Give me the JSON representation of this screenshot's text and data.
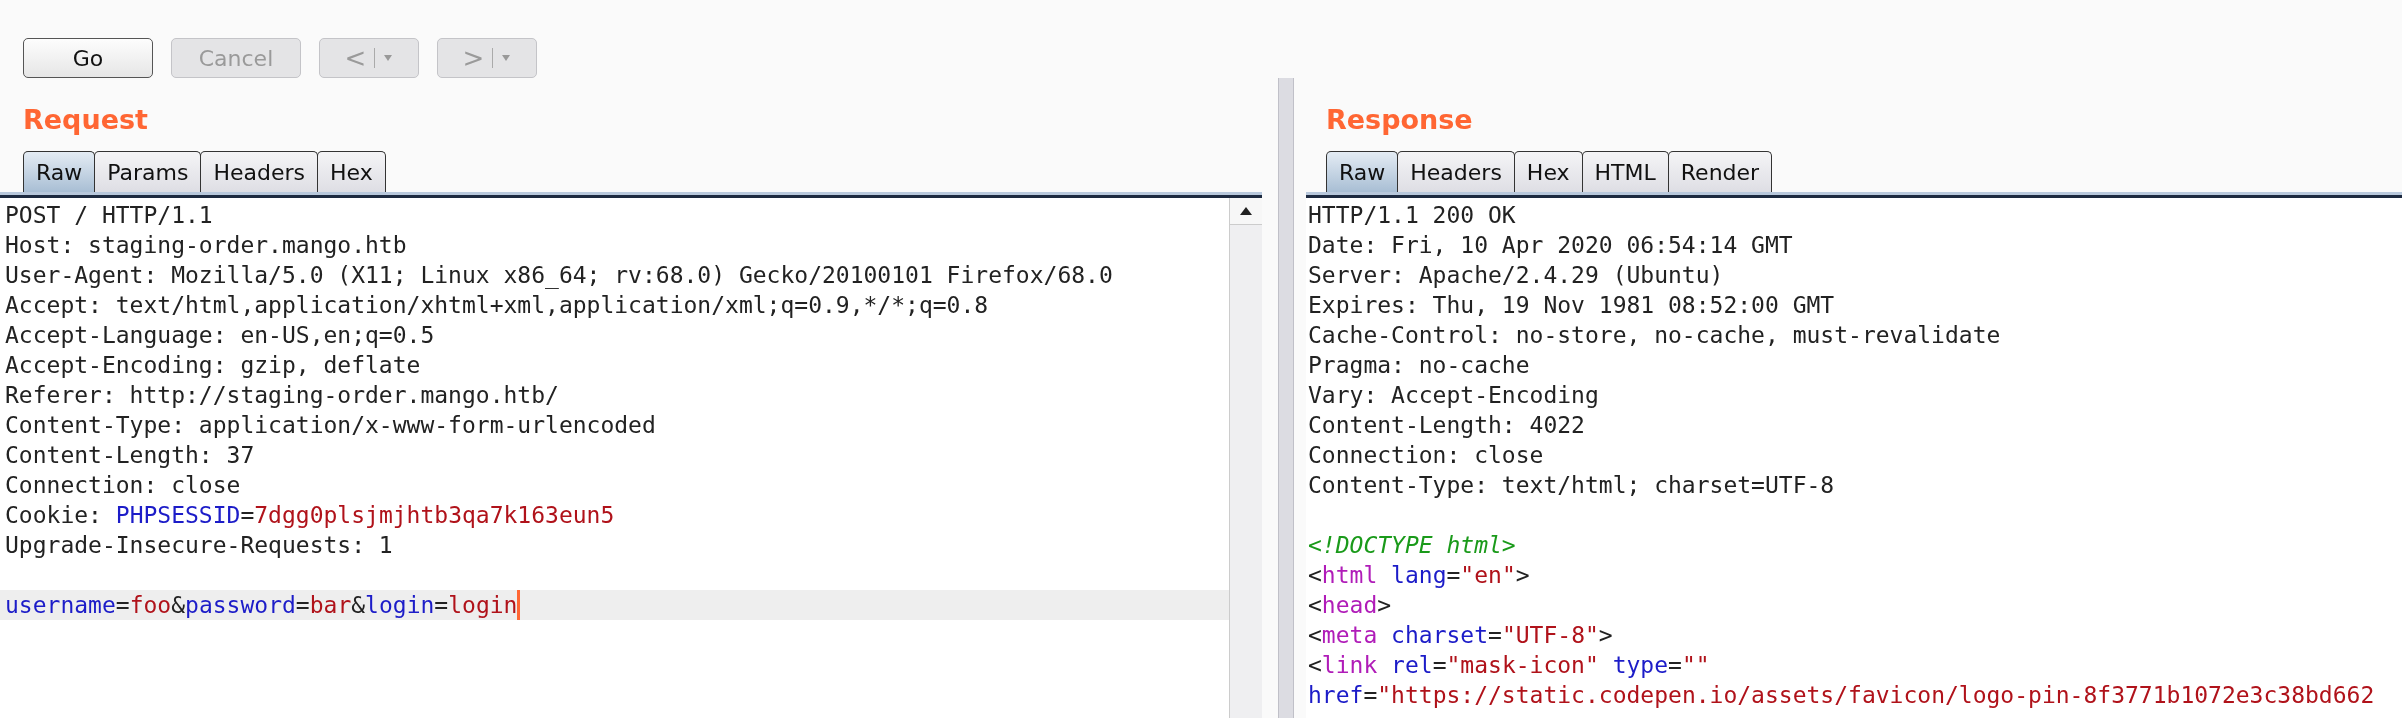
{
  "toolbar": {
    "buttons": [
      {
        "label": "Go",
        "kind": "text",
        "disabled": false
      },
      {
        "label": "Cancel",
        "kind": "text",
        "disabled": true
      },
      {
        "label": "<",
        "kind": "nav",
        "disabled": true
      },
      {
        "label": ">",
        "kind": "nav",
        "disabled": true
      }
    ]
  },
  "request": {
    "title": "Request",
    "tabs": [
      {
        "label": "Raw",
        "selected": true
      },
      {
        "label": "Params",
        "selected": false
      },
      {
        "label": "Headers",
        "selected": false
      },
      {
        "label": "Hex",
        "selected": false
      }
    ],
    "lines": [
      {
        "kind": "text",
        "current": false,
        "segments": [
          {
            "kind": "plain",
            "text": "POST / HTTP/1.1"
          }
        ]
      },
      {
        "kind": "text",
        "current": false,
        "segments": [
          {
            "kind": "plain",
            "text": "Host: staging-order.mango.htb"
          }
        ]
      },
      {
        "kind": "text",
        "current": false,
        "segments": [
          {
            "kind": "plain",
            "text": "User-Agent: Mozilla/5.0 (X11; Linux x86_64; rv:68.0) Gecko/20100101 Firefox/68.0"
          }
        ]
      },
      {
        "kind": "text",
        "current": false,
        "segments": [
          {
            "kind": "plain",
            "text": "Accept: text/html,application/xhtml+xml,application/xml;q=0.9,*/*;q=0.8"
          }
        ]
      },
      {
        "kind": "text",
        "current": false,
        "segments": [
          {
            "kind": "plain",
            "text": "Accept-Language: en-US,en;q=0.5"
          }
        ]
      },
      {
        "kind": "text",
        "current": false,
        "segments": [
          {
            "kind": "plain",
            "text": "Accept-Encoding: gzip, deflate"
          }
        ]
      },
      {
        "kind": "text",
        "current": false,
        "segments": [
          {
            "kind": "plain",
            "text": "Referer: http://staging-order.mango.htb/"
          }
        ]
      },
      {
        "kind": "text",
        "current": false,
        "segments": [
          {
            "kind": "plain",
            "text": "Content-Type: application/x-www-form-urlencoded"
          }
        ]
      },
      {
        "kind": "text",
        "current": false,
        "segments": [
          {
            "kind": "plain",
            "text": "Content-Length: 37"
          }
        ]
      },
      {
        "kind": "text",
        "current": false,
        "segments": [
          {
            "kind": "plain",
            "text": "Connection: close"
          }
        ]
      },
      {
        "kind": "text",
        "current": false,
        "segments": [
          {
            "kind": "plain",
            "text": "Cookie: "
          },
          {
            "kind": "name",
            "text": "PHPSESSID"
          },
          {
            "kind": "plain",
            "text": "="
          },
          {
            "kind": "value",
            "text": "7dgg0plsjmjhtb3qa7k163eun5"
          }
        ]
      },
      {
        "kind": "text",
        "current": false,
        "segments": [
          {
            "kind": "plain",
            "text": "Upgrade-Insecure-Requests: 1"
          }
        ]
      },
      {
        "kind": "blank",
        "current": false
      },
      {
        "kind": "text",
        "current": true,
        "segments": [
          {
            "kind": "name",
            "text": "username"
          },
          {
            "kind": "plain",
            "text": "="
          },
          {
            "kind": "value",
            "text": "foo"
          },
          {
            "kind": "plain",
            "text": "&"
          },
          {
            "kind": "name",
            "text": "password"
          },
          {
            "kind": "plain",
            "text": "="
          },
          {
            "kind": "value",
            "text": "bar"
          },
          {
            "kind": "plain",
            "text": "&"
          },
          {
            "kind": "name",
            "text": "login"
          },
          {
            "kind": "plain",
            "text": "="
          },
          {
            "kind": "value",
            "text": "login"
          }
        ]
      }
    ]
  },
  "response": {
    "title": "Response",
    "tabs": [
      {
        "label": "Raw",
        "selected": true
      },
      {
        "label": "Headers",
        "selected": false
      },
      {
        "label": "Hex",
        "selected": false
      },
      {
        "label": "HTML",
        "selected": false
      },
      {
        "label": "Render",
        "selected": false
      }
    ],
    "lines": [
      {
        "kind": "text",
        "segments": [
          {
            "kind": "plain",
            "text": "HTTP/1.1 200 OK"
          }
        ]
      },
      {
        "kind": "text",
        "segments": [
          {
            "kind": "plain",
            "text": "Date: Fri, 10 Apr 2020 06:54:14 GMT"
          }
        ]
      },
      {
        "kind": "text",
        "segments": [
          {
            "kind": "plain",
            "text": "Server: Apache/2.4.29 (Ubuntu)"
          }
        ]
      },
      {
        "kind": "text",
        "segments": [
          {
            "kind": "plain",
            "text": "Expires: Thu, 19 Nov 1981 08:52:00 GMT"
          }
        ]
      },
      {
        "kind": "text",
        "segments": [
          {
            "kind": "plain",
            "text": "Cache-Control: no-store, no-cache, must-revalidate"
          }
        ]
      },
      {
        "kind": "text",
        "segments": [
          {
            "kind": "plain",
            "text": "Pragma: no-cache"
          }
        ]
      },
      {
        "kind": "text",
        "segments": [
          {
            "kind": "plain",
            "text": "Vary: Accept-Encoding"
          }
        ]
      },
      {
        "kind": "text",
        "segments": [
          {
            "kind": "plain",
            "text": "Content-Length: 4022"
          }
        ]
      },
      {
        "kind": "text",
        "segments": [
          {
            "kind": "plain",
            "text": "Connection: close"
          }
        ]
      },
      {
        "kind": "text",
        "segments": [
          {
            "kind": "plain",
            "text": "Content-Type: text/html; charset=UTF-8"
          }
        ]
      },
      {
        "kind": "blank"
      },
      {
        "kind": "text",
        "segments": [
          {
            "kind": "comment",
            "text": "<!DOCTYPE html>"
          }
        ]
      },
      {
        "kind": "text",
        "segments": [
          {
            "kind": "plain",
            "text": "<"
          },
          {
            "kind": "tag",
            "text": "html"
          },
          {
            "kind": "attr",
            "text": " lang"
          },
          {
            "kind": "plain",
            "text": "="
          },
          {
            "kind": "value",
            "text": "\"en\""
          },
          {
            "kind": "plain",
            "text": ">"
          }
        ]
      },
      {
        "kind": "text",
        "segments": [
          {
            "kind": "plain",
            "text": "<"
          },
          {
            "kind": "tag",
            "text": "head"
          },
          {
            "kind": "plain",
            "text": ">"
          }
        ]
      },
      {
        "kind": "text",
        "segments": [
          {
            "kind": "plain",
            "text": "<"
          },
          {
            "kind": "tag",
            "text": "meta"
          },
          {
            "kind": "attr",
            "text": " charset"
          },
          {
            "kind": "plain",
            "text": "="
          },
          {
            "kind": "value",
            "text": "\"UTF-8\""
          },
          {
            "kind": "plain",
            "text": ">"
          }
        ]
      },
      {
        "kind": "text",
        "segments": [
          {
            "kind": "plain",
            "text": "<"
          },
          {
            "kind": "tag",
            "text": "link"
          },
          {
            "kind": "attr",
            "text": " rel"
          },
          {
            "kind": "plain",
            "text": "="
          },
          {
            "kind": "value",
            "text": "\"mask-icon\""
          },
          {
            "kind": "attr",
            "text": " type"
          },
          {
            "kind": "plain",
            "text": "="
          },
          {
            "kind": "value",
            "text": "\"\""
          }
        ]
      },
      {
        "kind": "text",
        "segments": [
          {
            "kind": "attr",
            "text": "href"
          },
          {
            "kind": "plain",
            "text": "="
          },
          {
            "kind": "value",
            "text": "\"https://static.codepen.io/assets/favicon/logo-pin-8f3771b1072e3c38bd662"
          }
        ]
      }
    ]
  }
}
